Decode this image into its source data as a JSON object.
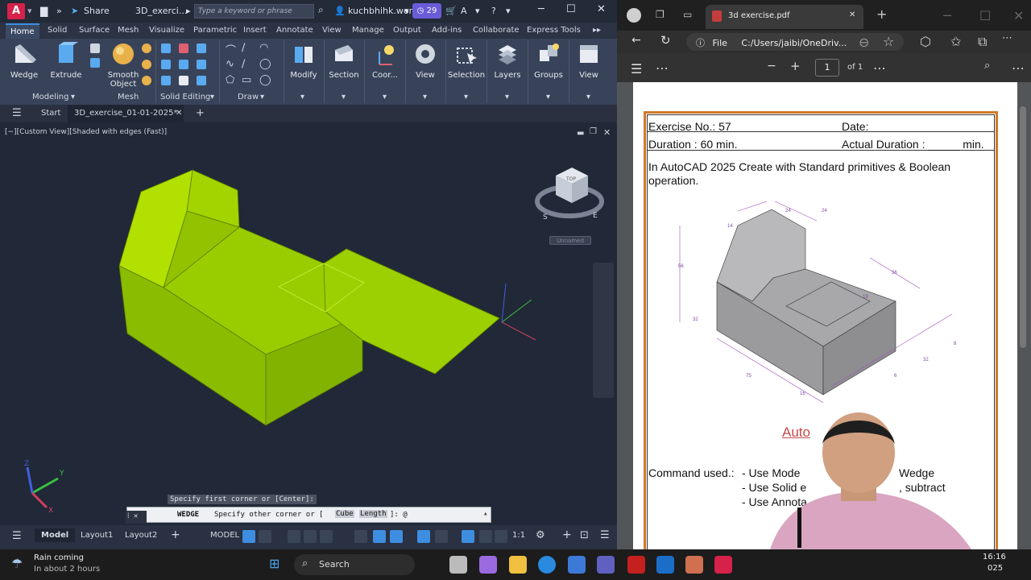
{
  "autocad": {
    "app_letter": "A",
    "share_label": "Share",
    "window_title": "3D_exerci...",
    "search_placeholder": "Type a keyword or phrase",
    "user": "kuchbhihk.work",
    "notification_count": "29",
    "ribbon_tabs": [
      "Home",
      "Solid",
      "Surface",
      "Mesh",
      "Visualize",
      "Parametric",
      "Insert",
      "Annotate",
      "View",
      "Manage",
      "Output",
      "Add-ins",
      "Collaborate",
      "Express Tools"
    ],
    "ribbon_buttons": {
      "wedge": "Wedge",
      "extrude": "Extrude",
      "smooth": "Smooth",
      "object": "Object",
      "modify": "Modify",
      "section": "Section",
      "coord": "Coor...",
      "view": "View",
      "selection": "Selection",
      "layers": "Layers",
      "groups": "Groups",
      "view2": "View"
    },
    "ribbon_panels": {
      "modeling": "Modeling",
      "mesh": "Mesh",
      "solid_editing": "Solid Editing",
      "draw": "Draw"
    },
    "file_tabs": {
      "start": "Start",
      "current": "3D_exercise_01-01-2025*"
    },
    "viewport_label": "[−][Custom View][Shaded with edges (Fast)]",
    "viewcube_label": "Unnamed",
    "cmd_history": "Specify first corner or [Center]:",
    "cmd_name": "WEDGE",
    "cmd_prompt": "Specify other corner or [",
    "cmd_opt1": "Cube",
    "cmd_opt2": "Length",
    "cmd_end": "]: @",
    "layout_tabs": {
      "model": "Model",
      "layout1": "Layout1",
      "layout2": "Layout2"
    },
    "status_model": "MODEL",
    "status_scale": "1:1",
    "colors": {
      "solid": "#9acd00",
      "accent": "#3d8ee0"
    }
  },
  "edge": {
    "tab_title": "3d exercise.pdf",
    "file_label": "File",
    "url": "C:/Users/jaibi/OneDriv...",
    "page_number": "1",
    "page_total": "of 1"
  },
  "pdf": {
    "exercise_no": "Exercise No.: 57",
    "date": "Date:",
    "duration": "Duration : 60 min.",
    "actual_duration": "Actual Duration : _____ min.",
    "instruction_line1": "In AutoCAD 2025 Create with Standard primitives & Boolean",
    "instruction_line2": "operation.",
    "red_fragment": "Auto",
    "command_used": "Command used.:",
    "item1_a": "- Use Mode",
    "item1_b": "Wedge",
    "item2_a": "- Use Solid e",
    "item2_b": ", subtract",
    "item3_a": "- Use Annota",
    "dims": {
      "top1": "24",
      "top2": "24",
      "left": "14",
      "height": "56",
      "mid": "32",
      "slot": "36",
      "base": "75",
      "small": "16",
      "right1": "32",
      "right2": "8",
      "front": "6",
      "angle": "19"
    }
  },
  "taskbar": {
    "weather_title": "Rain coming",
    "weather_sub": "In about 2 hours",
    "search": "Search",
    "time": "16:16",
    "date": "025"
  }
}
